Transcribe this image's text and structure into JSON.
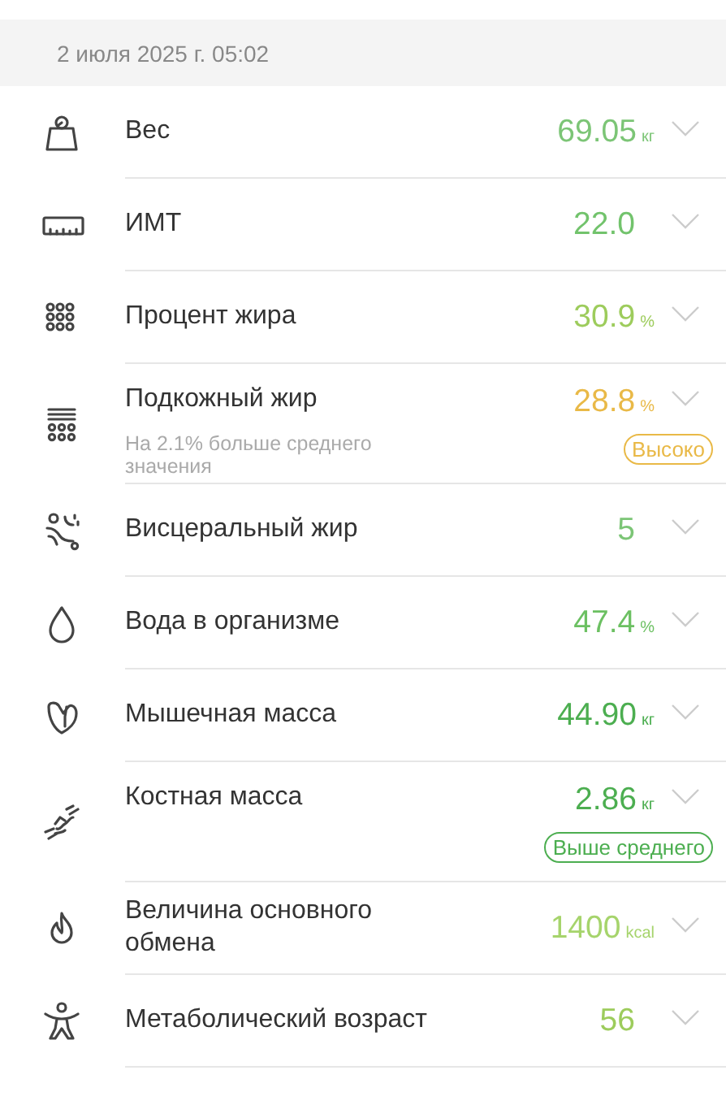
{
  "header": {
    "date": "2 июля 2025 г. 05:02"
  },
  "metrics": [
    {
      "label": "Вес",
      "value": "69.05",
      "unit": "кг",
      "color": "#7cc576"
    },
    {
      "label": "ИМТ",
      "value": "22.0",
      "color": "#72c36c"
    },
    {
      "label": "Процент жира",
      "value": "30.9",
      "unit": "%",
      "color": "#9dcc5c"
    },
    {
      "label": "Подкожный жир",
      "value": "28.8",
      "unit": "%",
      "color": "#e9b947",
      "note": "На 2.1% больше среднего значения",
      "badge": "Высоко"
    },
    {
      "label": "Висцеральный жир",
      "value": "5",
      "color": "#7cc576"
    },
    {
      "label": "Вода в организме",
      "value": "47.4",
      "unit": "%",
      "color": "#6cc062"
    },
    {
      "label": "Мышечная масса",
      "value": "44.90",
      "unit": "кг",
      "color": "#4cae50"
    },
    {
      "label": "Костная масса",
      "value": "2.86",
      "unit": "кг",
      "color": "#4cae50",
      "badge": "Выше среднего"
    },
    {
      "label": "Величина основного обмена",
      "value": "1400",
      "unit": "kcal",
      "color": "#a6d46c"
    },
    {
      "label": "Метаболический возраст",
      "value": "56",
      "color": "#9dcc5c"
    }
  ]
}
